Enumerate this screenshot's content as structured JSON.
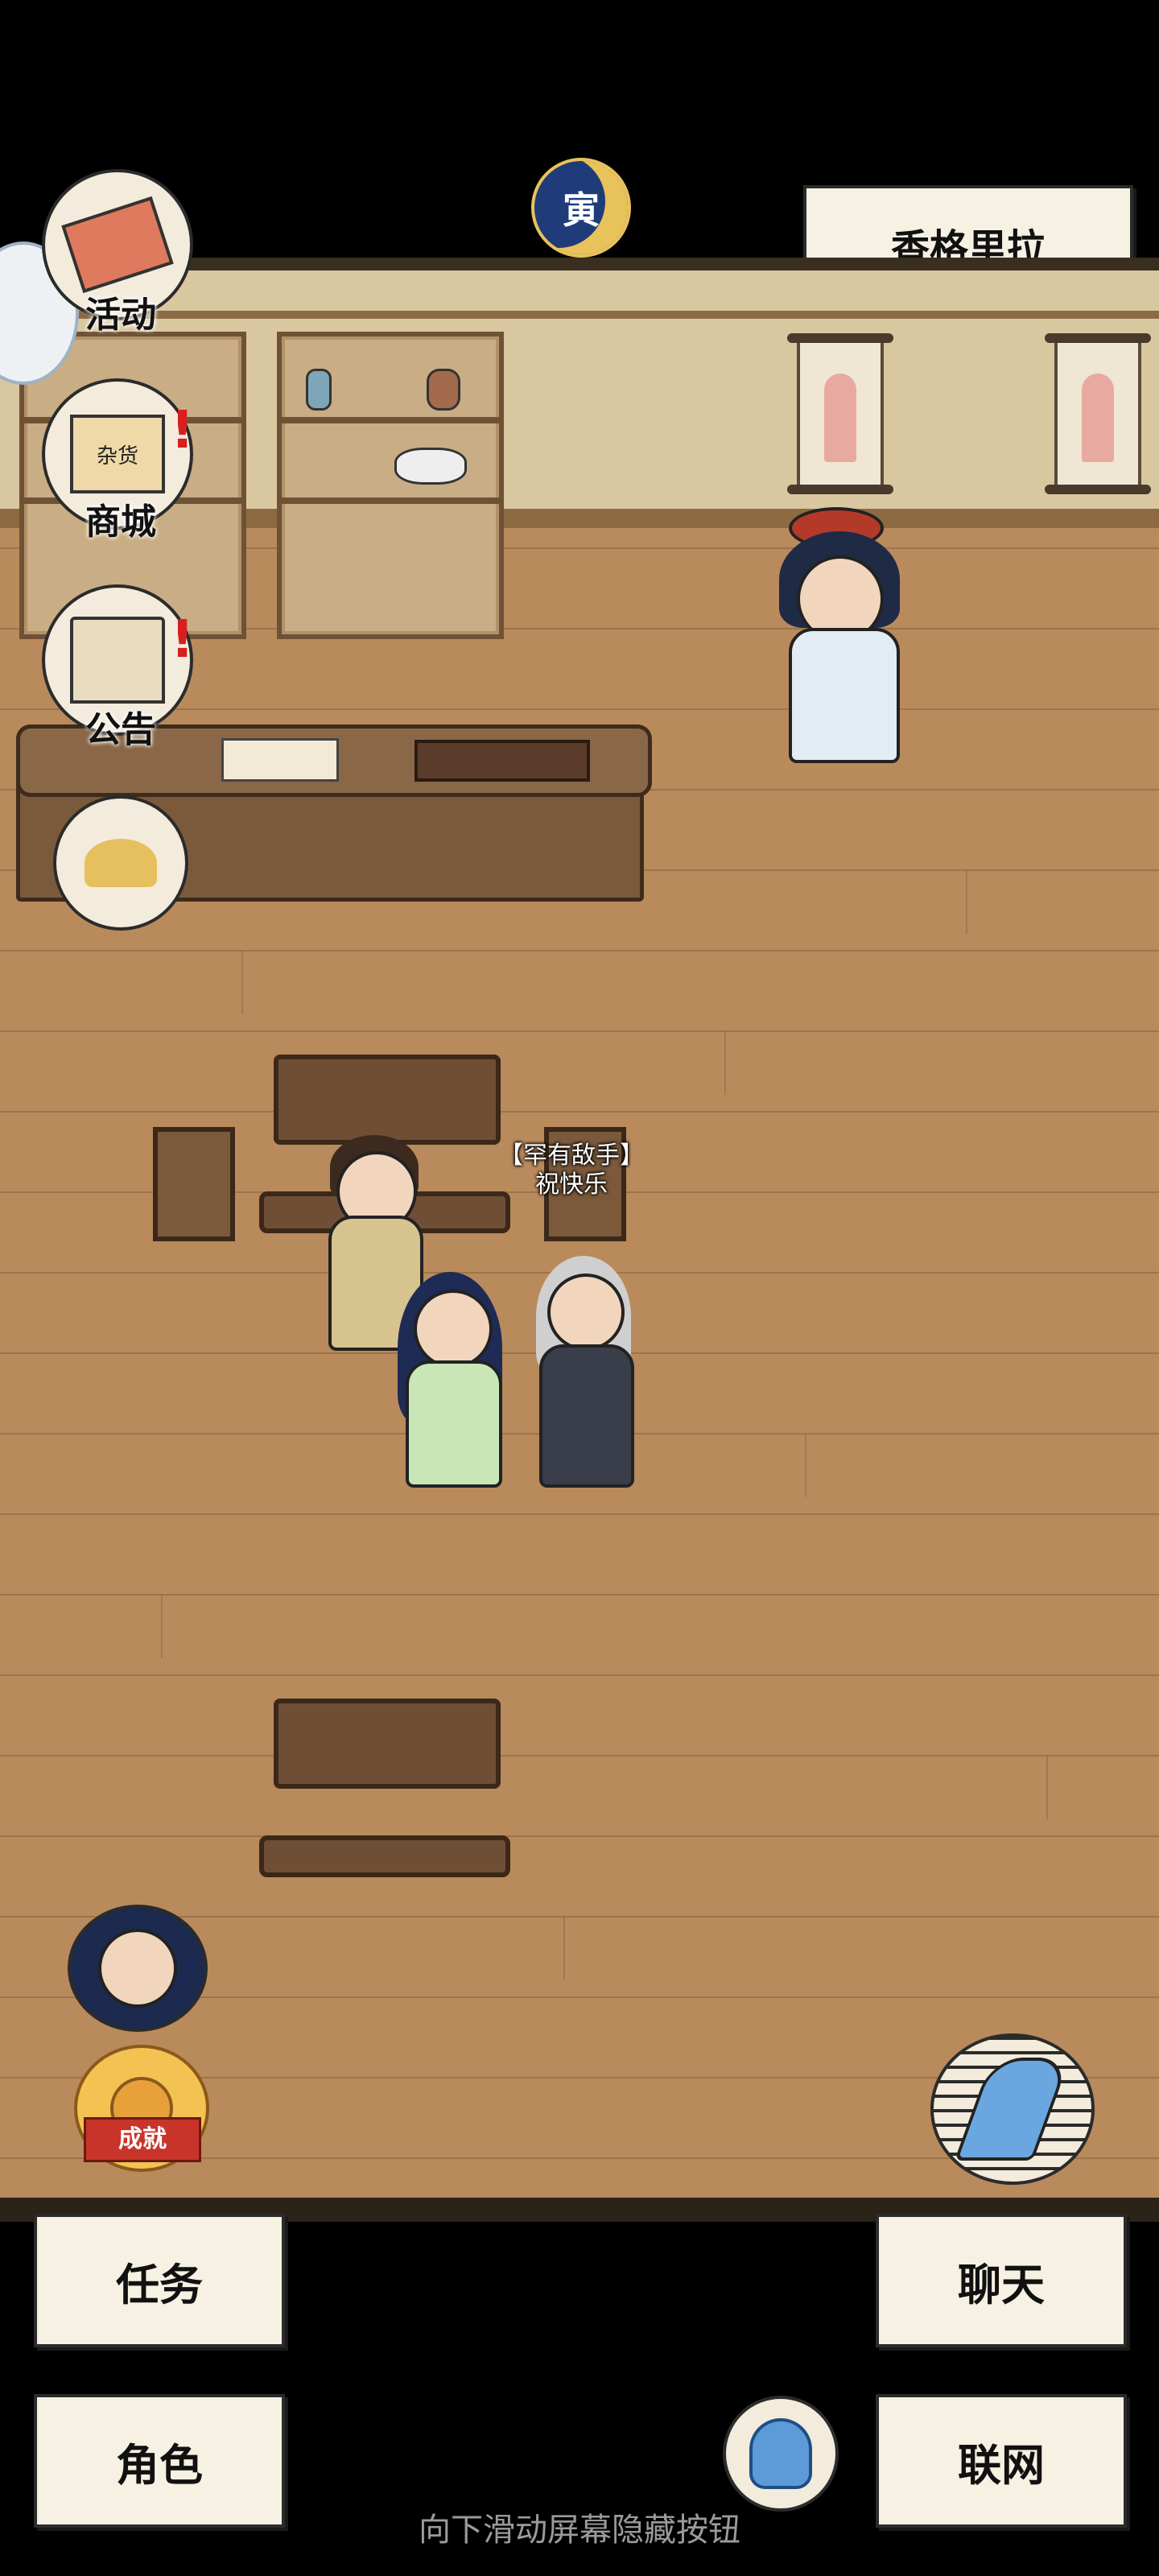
{
  "location": {
    "name": "香格里拉"
  },
  "time_icon": {
    "glyph": "寅",
    "name": "moon-time-icon"
  },
  "side_menu": [
    {
      "label": "活动",
      "icon": "banner-flag-icon",
      "alert": false
    },
    {
      "label": "商城",
      "icon": "shop-stall-icon",
      "alert": true,
      "sign": "杂货"
    },
    {
      "label": "公告",
      "icon": "notice-pavilion-icon",
      "alert": true
    },
    {
      "label": "",
      "icon": "wheat-grain-icon",
      "alert": false
    }
  ],
  "alert_mark": "!",
  "player": {
    "title": "【罕有敌手】",
    "name": "祝快乐"
  },
  "portrait": {
    "icon": "companion-portrait-icon"
  },
  "achievement": {
    "label": "成就"
  },
  "buttons": {
    "quest": "任务",
    "chat": "聊天",
    "character": "角色",
    "network": "联网"
  },
  "hint": "向下滑动屏幕隐藏按钮",
  "colors": {
    "floor": "#b98a5c",
    "button_paper": "#f7f1e3",
    "alert_red": "#d81f1f"
  }
}
